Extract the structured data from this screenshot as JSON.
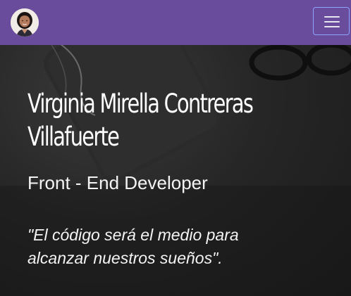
{
  "navbar": {
    "avatar_alt": "profile photo",
    "toggle_icon": "hamburger-icon",
    "brand_color": "#6a4c9c",
    "toggle_border_color": "#8ea2ff"
  },
  "hero": {
    "name": "Virginia Mirella Contreras Villafuerte",
    "role": "Front - End Developer",
    "quote": "\"El código será el medio para alcanzar nuestros sueños\".",
    "background_color": "#1e1e1e",
    "text_color": "#ffffff"
  }
}
